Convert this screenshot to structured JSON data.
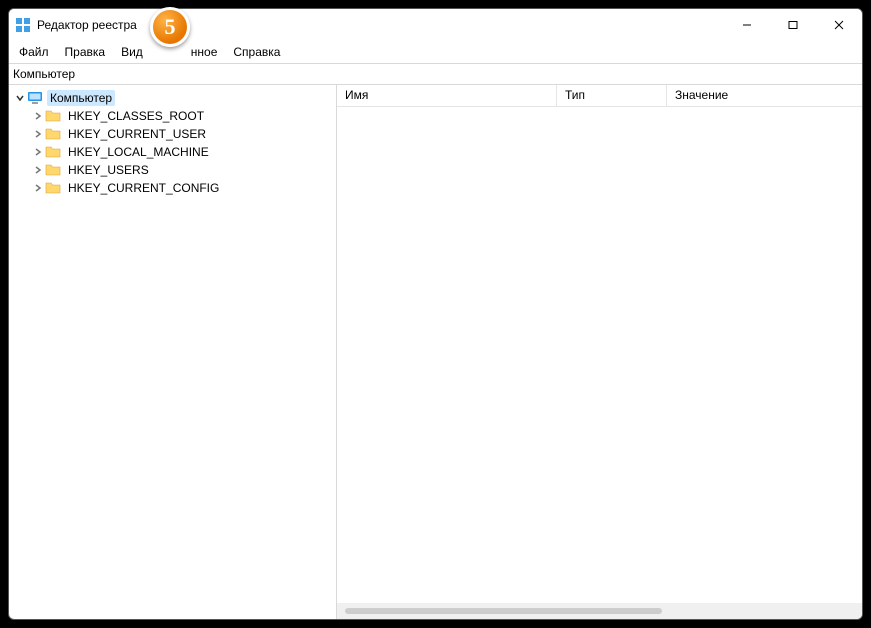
{
  "window": {
    "title": "Редактор реестра",
    "menu": {
      "file": "Файл",
      "edit": "Правка",
      "view": "Вид",
      "favorites_suffix": "нное",
      "help": "Справка"
    },
    "address": "Компьютер"
  },
  "tree": {
    "root": {
      "label": "Компьютер"
    },
    "children": [
      {
        "label": "HKEY_CLASSES_ROOT"
      },
      {
        "label": "HKEY_CURRENT_USER"
      },
      {
        "label": "HKEY_LOCAL_MACHINE"
      },
      {
        "label": "HKEY_USERS"
      },
      {
        "label": "HKEY_CURRENT_CONFIG"
      }
    ]
  },
  "columns": {
    "name": "Имя",
    "type": "Тип",
    "value": "Значение"
  },
  "badge": {
    "number": "5"
  }
}
